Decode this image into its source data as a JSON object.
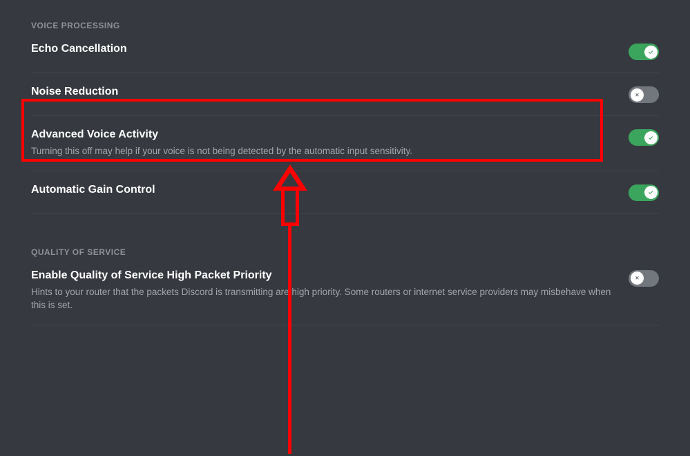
{
  "voiceProcessing": {
    "header": "VOICE PROCESSING",
    "settings": [
      {
        "label": "Echo Cancellation",
        "description": "",
        "enabled": true
      },
      {
        "label": "Noise Reduction",
        "description": "",
        "enabled": false
      },
      {
        "label": "Advanced Voice Activity",
        "description": "Turning this off may help if your voice is not being detected by the automatic input sensitivity.",
        "enabled": true
      },
      {
        "label": "Automatic Gain Control",
        "description": "",
        "enabled": true
      }
    ]
  },
  "qualityOfService": {
    "header": "QUALITY OF SERVICE",
    "settings": [
      {
        "label": "Enable Quality of Service High Packet Priority",
        "description": "Hints to your router that the packets Discord is transmitting are high priority. Some routers or internet service providers may misbehave when this is set.",
        "enabled": false
      }
    ]
  }
}
